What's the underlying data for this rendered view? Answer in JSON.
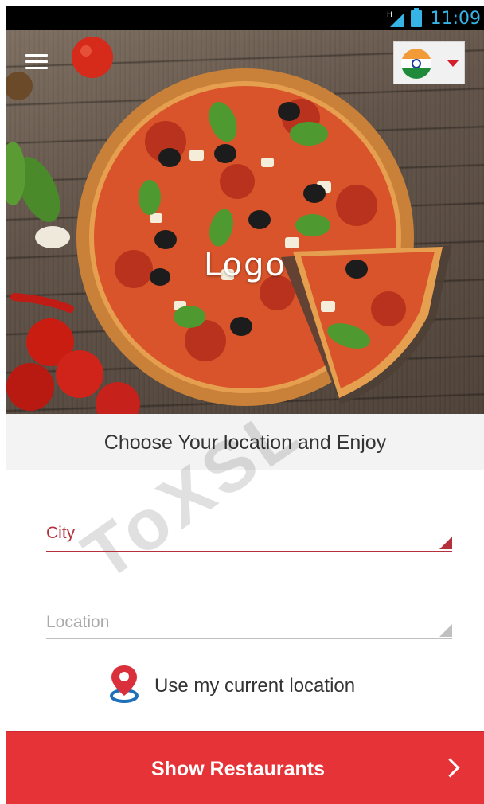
{
  "status_bar": {
    "network_indicator": "H",
    "time": "11:09",
    "colors": {
      "icons": "#36b4e5"
    }
  },
  "header": {
    "menu_icon": "hamburger-menu-icon",
    "logo_text": "Logo",
    "country_selector": {
      "flag": "india-flag-icon",
      "caret": "caret-down-icon"
    }
  },
  "location_prompt": "Choose Your location and Enjoy",
  "form": {
    "city_label": "City",
    "location_placeholder": "Location"
  },
  "current_location": {
    "icon": "location-pin-icon",
    "label": "Use my current location"
  },
  "primary_button": {
    "label": "Show Restaurants",
    "icon": "chevron-right-icon",
    "color": "#e53338"
  },
  "watermark": "ToXSL",
  "theme": {
    "accent": "#b4313c"
  }
}
